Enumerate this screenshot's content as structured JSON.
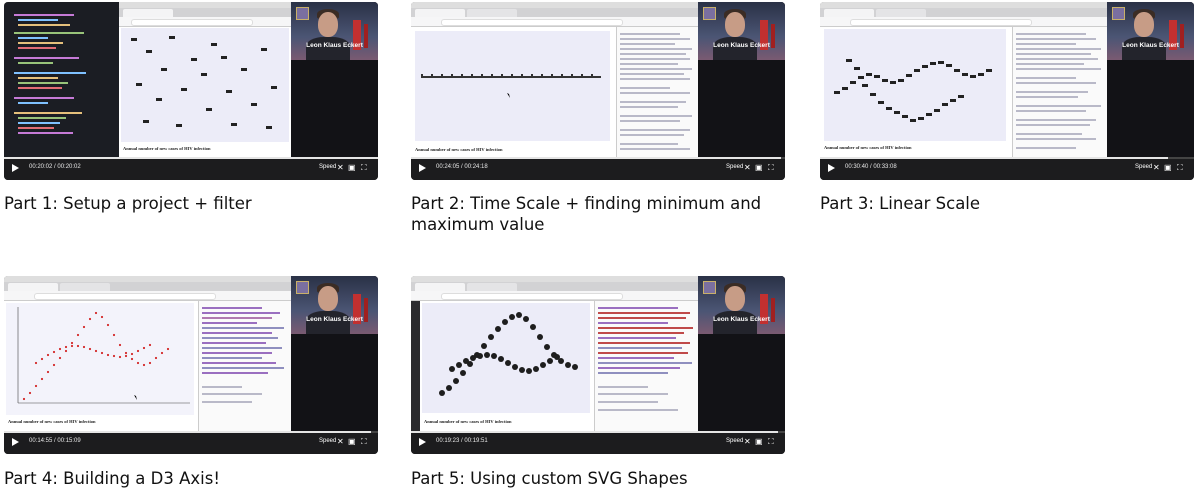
{
  "videos": [
    {
      "title": "Part 1: Setup a project + filter",
      "time": "00:20:02 / 00:20:02",
      "progress": 1.0,
      "presenter": "Leon Klaus Eckert",
      "caption": "Annual number of new cases of HIV infection"
    },
    {
      "title": "Part 2: Time Scale + finding minimum and maximum value",
      "time": "00:24:05 / 00:24:18",
      "progress": 0.99,
      "presenter": "Leon Klaus Eckert",
      "caption": "Annual number of new cases of HIV infection"
    },
    {
      "title": "Part 3: Linear Scale",
      "time": "00:30:40 / 00:33:08",
      "progress": 0.93,
      "presenter": "Leon Klaus Eckert",
      "caption": "Annual number of new cases of HIV infection"
    },
    {
      "title": "Part 4: Building a D3 Axis!",
      "time": "00:14:55 / 00:15:09",
      "progress": 0.98,
      "presenter": "Leon Klaus Eckert",
      "caption": "Annual number of new cases of HIV infection"
    },
    {
      "title": "Part 5: Using custom SVG Shapes",
      "time": "00:19:23 / 00:19:51",
      "progress": 0.98,
      "presenter": "Leon Klaus Eckert",
      "caption": "Annual number of new cases of HIV infection"
    }
  ],
  "player": {
    "speed_label": "Speed"
  },
  "colors": {
    "player_bg": "#1c1c1e",
    "plot_bg": "#ececf8",
    "accent": "#c23030"
  }
}
